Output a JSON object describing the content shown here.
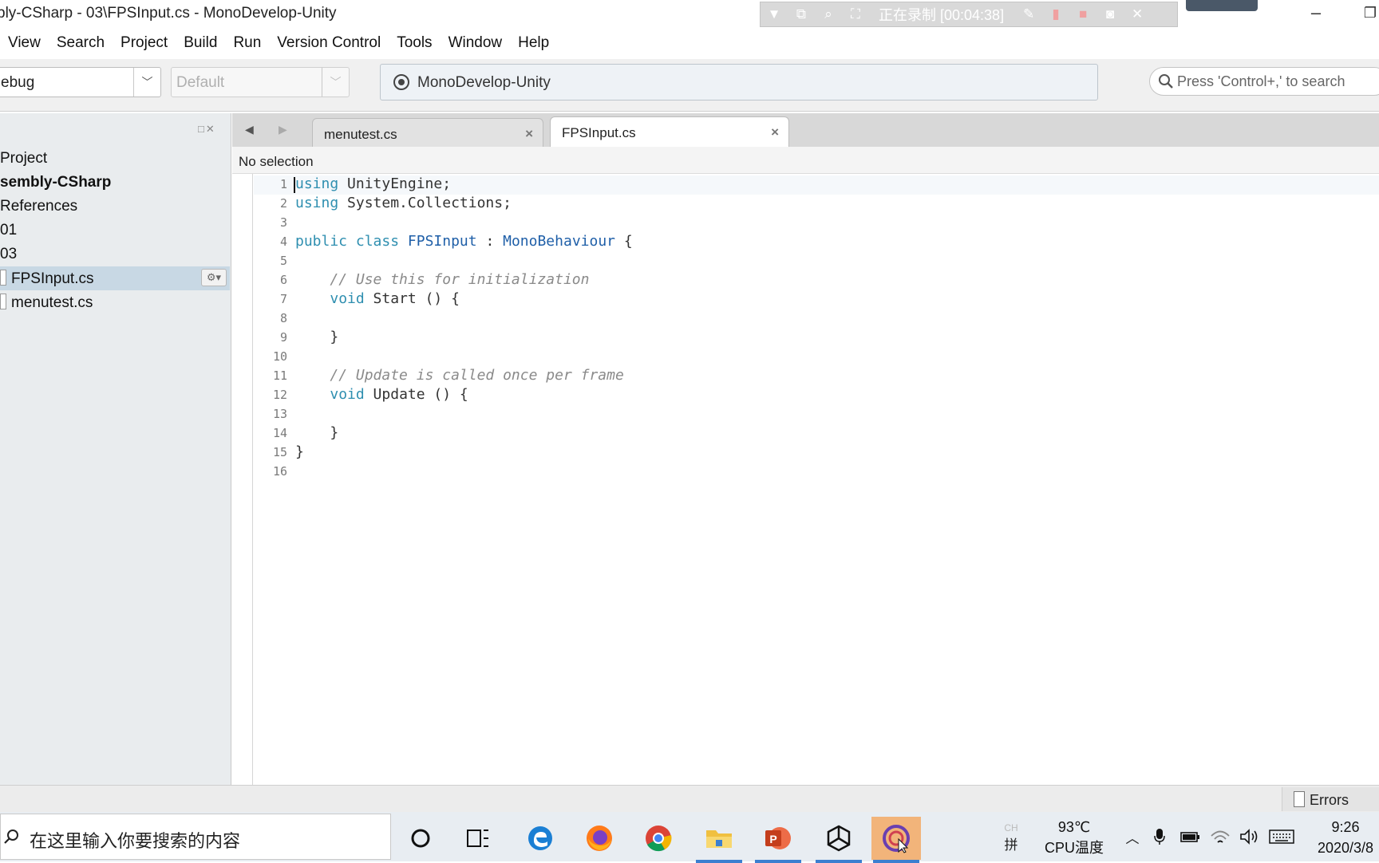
{
  "window": {
    "title": "bly-CSharp - 03\\FPSInput.cs - MonoDevelop-Unity",
    "recorder_status": "正在录制 [00:04:38]"
  },
  "menu": {
    "items": [
      "View",
      "Search",
      "Project",
      "Build",
      "Run",
      "Version Control",
      "Tools",
      "Window",
      "Help"
    ]
  },
  "toolbar": {
    "configuration": "ebug",
    "platform": "Default",
    "status": "MonoDevelop-Unity",
    "search_placeholder": "Press 'Control+,' to search"
  },
  "solution_pad": {
    "items": [
      {
        "label": "Project"
      },
      {
        "label": "sembly-CSharp"
      },
      {
        "label": "References"
      },
      {
        "label": "01"
      },
      {
        "label": "03"
      },
      {
        "label": "FPSInput.cs"
      },
      {
        "label": "menutest.cs"
      }
    ]
  },
  "tabs": [
    {
      "label": "menutest.cs"
    },
    {
      "label": "FPSInput.cs"
    }
  ],
  "pathbar": {
    "text": "No selection"
  },
  "code": {
    "line_numbers": [
      "1",
      "2",
      "3",
      "4",
      "5",
      "6",
      "7",
      "8",
      "9",
      "10",
      "11",
      "12",
      "13",
      "14",
      "15",
      "16"
    ],
    "l1": {
      "kw": "using",
      "rest": " UnityEngine;"
    },
    "l2": {
      "kw": "using",
      "rest": " System.Collections;"
    },
    "l4": {
      "kw1": "public",
      "kw2": "class",
      "name": "FPSInput",
      "sep": " : ",
      "base": "MonoBehaviour",
      "rest": " {"
    },
    "l6": {
      "comment": "// Use this for initialization"
    },
    "l7": {
      "kw": "void",
      "rest": " Start () {"
    },
    "l9": {
      "rest": "}"
    },
    "l11": {
      "comment": "// Update is called once per frame"
    },
    "l12": {
      "kw": "void",
      "rest": " Update () {"
    },
    "l14": {
      "rest": "}"
    },
    "l15": {
      "rest": "}"
    }
  },
  "statusbar": {
    "errors_label": "Errors"
  },
  "taskbar": {
    "search_text": "在这里输入你要搜索的内容",
    "ime_lang": "CH",
    "ime_mode": "拼",
    "cpu_temp": "93℃",
    "cpu_label": "CPU温度",
    "time": "9:26",
    "date": "2020/3/8"
  }
}
